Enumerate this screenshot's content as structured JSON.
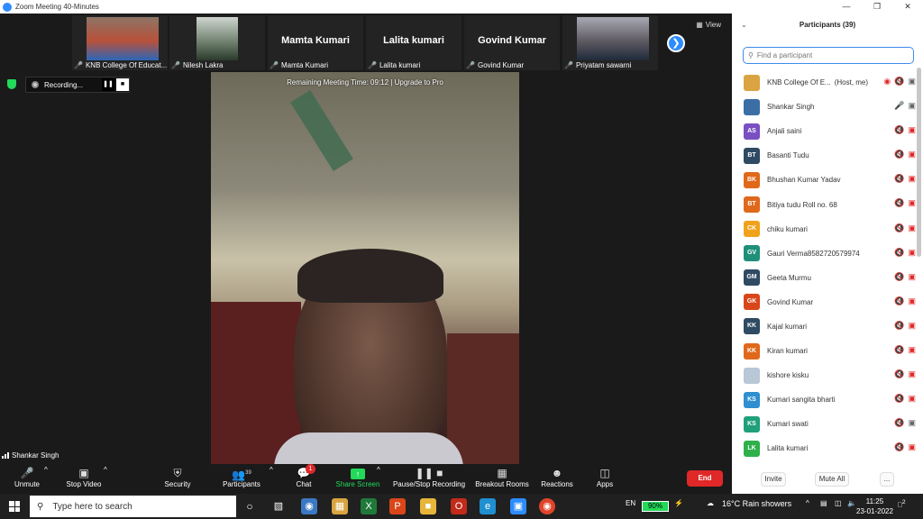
{
  "window": {
    "title": "Zoom Meeting 40-Minutes"
  },
  "strip": {
    "tiles": [
      {
        "label": "KNB College Of Educat...",
        "has_video": true
      },
      {
        "label": "Nilesh Lakra",
        "has_video": true
      },
      {
        "label": "Mamta Kumari",
        "big_name": "Mamta Kumari",
        "has_video": false
      },
      {
        "label": "Lalita kumari",
        "big_name": "Lalita kumari",
        "has_video": false
      },
      {
        "label": "Govind Kumar",
        "big_name": "Govind Kumar",
        "has_video": false
      },
      {
        "label": "Priyatam sawarni",
        "has_video": true
      }
    ],
    "view_label": "View"
  },
  "recording": {
    "label": "Recording..."
  },
  "remaining_time": "Remaining Meeting Time: 09:12 | Upgrade to Pro",
  "active_speaker": "Shankar Singh",
  "toolbar": {
    "unmute": "Unmute",
    "stop_video": "Stop Video",
    "security": "Security",
    "participants": "Participants",
    "participants_count": "39",
    "chat": "Chat",
    "chat_badge": "1",
    "share_screen": "Share Screen",
    "pause_stop_recording": "Pause/Stop Recording",
    "breakout_rooms": "Breakout Rooms",
    "reactions": "Reactions",
    "apps": "Apps",
    "end": "End"
  },
  "panel": {
    "title": "Participants (39)",
    "search_placeholder": "Find a participant",
    "participants": [
      {
        "initials": "",
        "name": "KNB College Of E...",
        "role": "(Host, me)",
        "color": "#d9a441",
        "photo": true,
        "mic": "on-record",
        "video": "on"
      },
      {
        "initials": "",
        "name": "Shankar Singh",
        "role": "",
        "color": "#3a6ea5",
        "photo": true,
        "mic": "on",
        "video": "on"
      },
      {
        "initials": "AS",
        "name": "Anjali saini",
        "role": "",
        "color": "#7a4fc2",
        "mic": "off",
        "video": "off"
      },
      {
        "initials": "BT",
        "name": "Basanti Tudu",
        "role": "",
        "color": "#2f4a63",
        "mic": "off",
        "video": "off"
      },
      {
        "initials": "BK",
        "name": "Bhushan Kumar Yadav",
        "role": "",
        "color": "#e0681a",
        "mic": "off",
        "video": "off"
      },
      {
        "initials": "BT",
        "name": "Bitiya tudu Roll no. 68",
        "role": "",
        "color": "#e0681a",
        "mic": "off",
        "video": "off"
      },
      {
        "initials": "CK",
        "name": "chiku kumari",
        "role": "",
        "color": "#f0a21c",
        "mic": "off",
        "video": "off"
      },
      {
        "initials": "GV",
        "name": "Gauri Verma8582720579974",
        "role": "",
        "color": "#1f8f7a",
        "mic": "off",
        "video": "off"
      },
      {
        "initials": "GM",
        "name": "Geeta Murmu",
        "role": "",
        "color": "#2f4a63",
        "mic": "off",
        "video": "off"
      },
      {
        "initials": "GK",
        "name": "Govind Kumar",
        "role": "",
        "color": "#d9461a",
        "mic": "off",
        "video": "off"
      },
      {
        "initials": "KK",
        "name": "Kajal kumari",
        "role": "",
        "color": "#2f4a63",
        "mic": "off",
        "video": "off"
      },
      {
        "initials": "KK",
        "name": "Kiran kumari",
        "role": "",
        "color": "#e0681a",
        "mic": "off",
        "video": "off"
      },
      {
        "initials": "",
        "name": "kishore kisku",
        "role": "",
        "color": "#b9c7d6",
        "photo": true,
        "mic": "off",
        "video": "off"
      },
      {
        "initials": "KS",
        "name": "Kumari sangita bharti",
        "role": "",
        "color": "#2f8fd0",
        "mic": "off",
        "video": "off"
      },
      {
        "initials": "KS",
        "name": "Kumari swati",
        "role": "",
        "color": "#1fa07a",
        "mic": "off",
        "video": "on"
      },
      {
        "initials": "LK",
        "name": "Lalita kumari",
        "role": "",
        "color": "#2fb04a",
        "mic": "off",
        "video": "off"
      }
    ],
    "invite": "Invite",
    "mute_all": "Mute All",
    "more": "..."
  },
  "taskbar": {
    "search_placeholder": "Type here to search",
    "lang": "EN",
    "battery": "90%",
    "weather": "16°C  Rain showers",
    "time": "11:25",
    "date": "23-01-2022",
    "notifications": "2"
  }
}
